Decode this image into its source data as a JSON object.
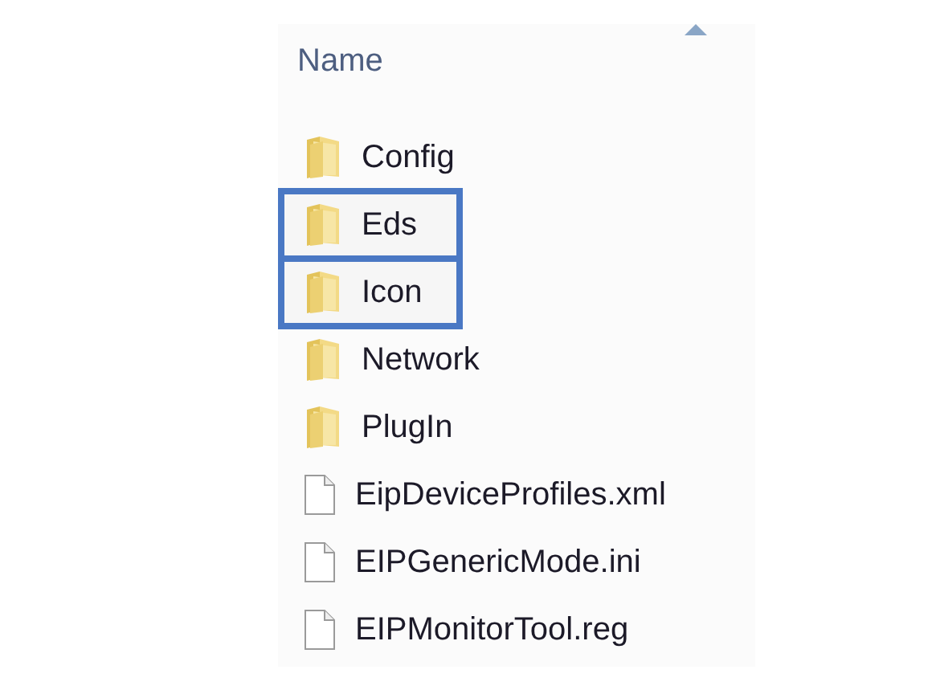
{
  "list": {
    "sort_column": "Name",
    "items": [
      {
        "name": "Config",
        "kind": "folder",
        "highlighted": false
      },
      {
        "name": "Eds",
        "kind": "folder",
        "highlighted": true
      },
      {
        "name": "Icon",
        "kind": "folder",
        "highlighted": true
      },
      {
        "name": "Network",
        "kind": "folder",
        "highlighted": false
      },
      {
        "name": "PlugIn",
        "kind": "folder",
        "highlighted": false
      },
      {
        "name": "EipDeviceProfiles.xml",
        "kind": "file",
        "highlighted": false
      },
      {
        "name": "EIPGenericMode.ini",
        "kind": "file",
        "highlighted": false
      },
      {
        "name": "EIPMonitorTool.reg",
        "kind": "file",
        "highlighted": false
      }
    ]
  }
}
